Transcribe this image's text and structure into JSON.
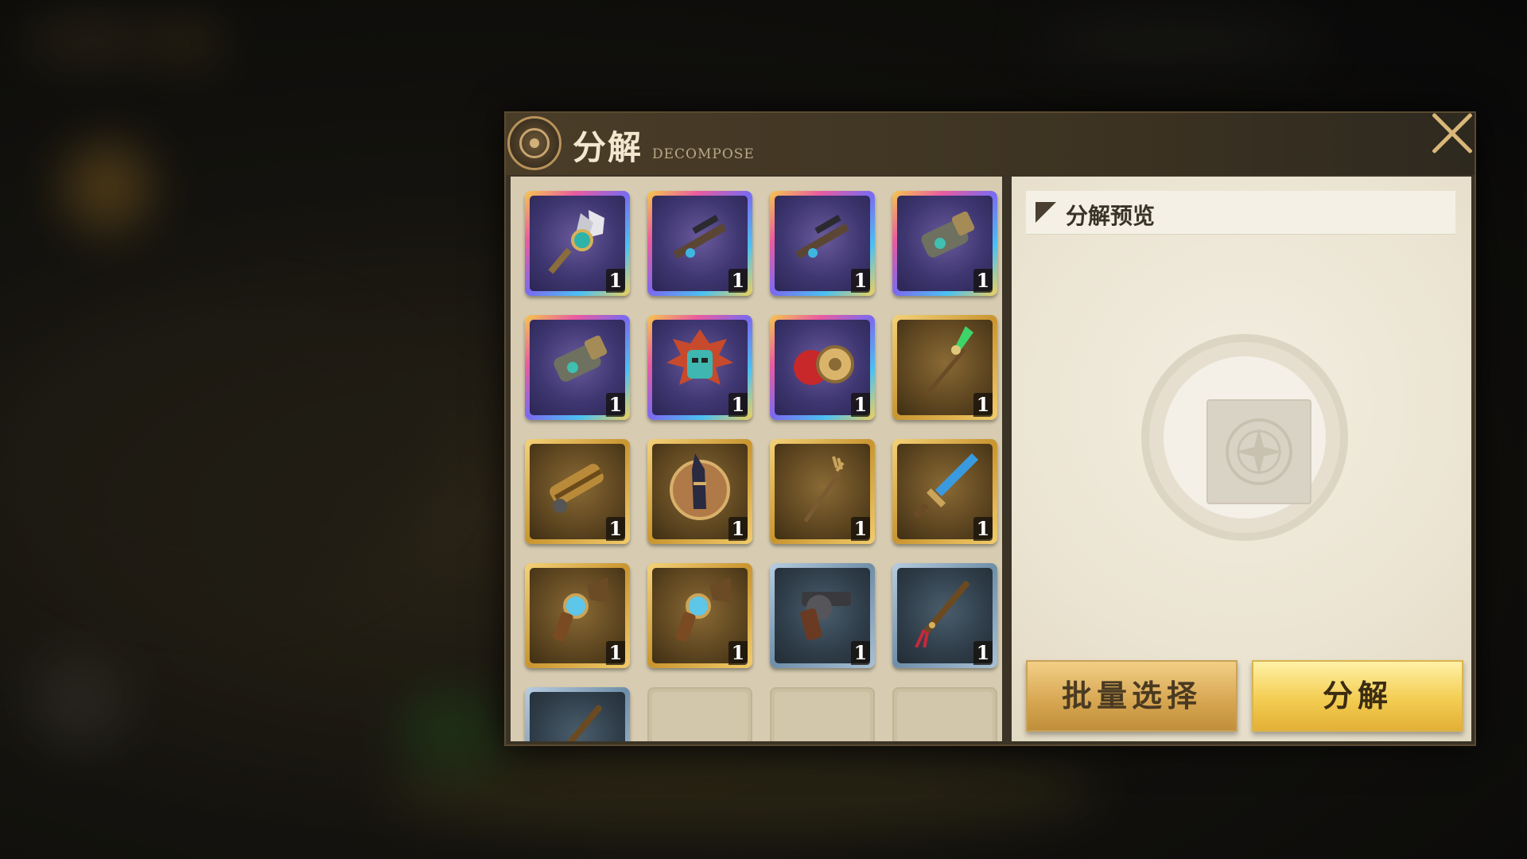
{
  "header": {
    "title": "分解",
    "subtitle": "DECOMPOSE"
  },
  "items": [
    {
      "name": "feather-scepter",
      "rarity": "rainbow",
      "count": "1"
    },
    {
      "name": "sniper-rifle",
      "rarity": "rainbow",
      "count": "1"
    },
    {
      "name": "sniper-rifle",
      "rarity": "rainbow",
      "count": "1"
    },
    {
      "name": "arm-cannon",
      "rarity": "rainbow",
      "count": "1"
    },
    {
      "name": "arm-cannon",
      "rarity": "rainbow",
      "count": "1"
    },
    {
      "name": "tribal-mask",
      "rarity": "rainbow",
      "count": "1"
    },
    {
      "name": "apple-and-ring",
      "rarity": "rainbow",
      "count": "1"
    },
    {
      "name": "jade-spear",
      "rarity": "gold",
      "count": "1"
    },
    {
      "name": "gatling-gun",
      "rarity": "gold",
      "count": "1"
    },
    {
      "name": "anubis-shield",
      "rarity": "gold",
      "count": "1"
    },
    {
      "name": "antler-staff",
      "rarity": "gold",
      "count": "1"
    },
    {
      "name": "crystal-sword",
      "rarity": "gold",
      "count": "1"
    },
    {
      "name": "horn-blunderbuss",
      "rarity": "gold",
      "count": "1"
    },
    {
      "name": "horn-blunderbuss",
      "rarity": "gold",
      "count": "1"
    },
    {
      "name": "revolver",
      "rarity": "blue",
      "count": "1"
    },
    {
      "name": "tasseled-rod",
      "rarity": "blue",
      "count": "1"
    },
    {
      "name": "tasseled-rod",
      "rarity": "blue",
      "count": ""
    }
  ],
  "empty_slots": 3,
  "preview": {
    "title": "分解预览"
  },
  "buttons": {
    "batch_select": "批量选择",
    "decompose": "分解"
  },
  "colors": {
    "panel_bg": "#3b3426",
    "items_bg": "#d7ccb1",
    "preview_bg": "#ebe4d2",
    "accent_gold": "#f3cd52",
    "close_x": "#d9b779"
  }
}
